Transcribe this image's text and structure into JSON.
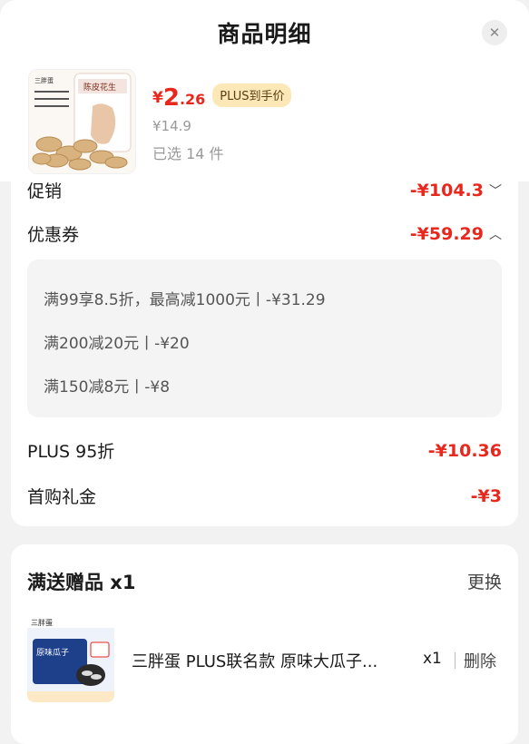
{
  "header": {
    "title": "商品明细",
    "close_icon": "close-icon"
  },
  "product": {
    "price_currency": "¥",
    "price_integer": "2",
    "price_decimal": ".26",
    "plus_tag": "PLUS到手价",
    "original_price": "¥14.9",
    "selected_count": "已选 14 件",
    "image_text": "陈皮花生",
    "brand_text": "三胖蛋"
  },
  "discounts": {
    "promotion": {
      "label": "促销",
      "value": "-¥104.3",
      "chevron": "chevron-down-icon"
    },
    "coupon": {
      "label": "优惠券",
      "value": "-¥59.29",
      "chevron": "chevron-up-icon"
    },
    "coupon_items": [
      "满99享8.5折，最高减1000元丨-¥31.29",
      "满200减20元丨-¥20",
      "满150减8元丨-¥8"
    ],
    "plus_discount": {
      "label": "PLUS 95折",
      "value": "-¥10.36"
    },
    "first_purchase": {
      "label": "首购礼金",
      "value": "-¥3"
    }
  },
  "gift": {
    "title": "满送赠品 x1",
    "change_label": "更换",
    "name": "三胖蛋 PLUS联名款 原味大瓜子...",
    "qty": "x1",
    "delete_label": "删除",
    "image_text": "原味瓜子",
    "image_subtext": "三胖蛋"
  },
  "colors": {
    "accent_red": "#e8271d",
    "plus_tag_bg": "#fbe8b6",
    "page_bg": "#f2f2f2"
  }
}
